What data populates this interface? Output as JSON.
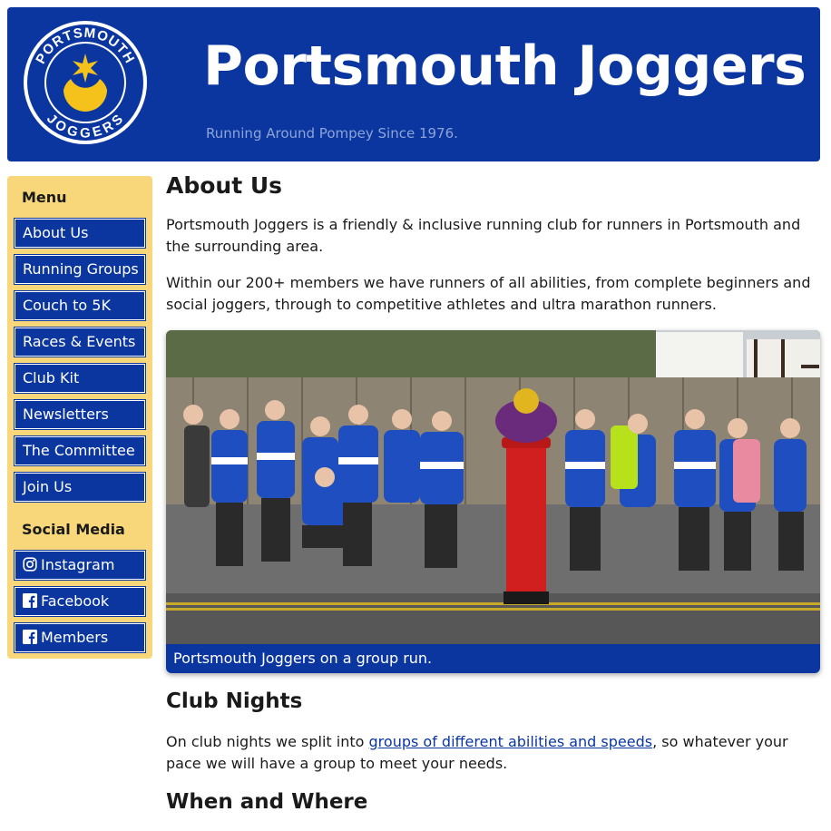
{
  "header": {
    "title": "Portsmouth Joggers",
    "tagline": "Running Around Pompey Since 1976.",
    "logo": {
      "top_text": "PORTSMOUTH",
      "bottom_text": "JOGGERS"
    },
    "brand_color": "#0b36a0",
    "accent_color": "#f5c21b"
  },
  "sidebar": {
    "menu_heading": "Menu",
    "menu": [
      "About Us",
      "Running Groups",
      "Couch to 5K",
      "Races & Events",
      "Club Kit",
      "Newsletters",
      "The Committee",
      "Join Us"
    ],
    "social_heading": "Social Media",
    "social": [
      {
        "label": "Instagram",
        "icon": "instagram-icon"
      },
      {
        "label": "Facebook",
        "icon": "facebook-icon"
      },
      {
        "label": "Members",
        "icon": "facebook-icon"
      }
    ],
    "background": "#f8d77a"
  },
  "main": {
    "heading": "About Us",
    "intro": "Portsmouth Joggers is a friendly & inclusive running club for runners in Portsmouth and the surrounding area.",
    "members_text": "Within our 200+ members we have runners of all abilities, from complete beginners and social joggers, through to competitive athletes and ultra marathon runners.",
    "photo_caption": "Portsmouth Joggers on a group run.",
    "club_nights": {
      "heading": "Club Nights",
      "text_before": "On club nights we split into ",
      "link": "groups of different abilities and speeds",
      "text_after": ", so whatever your pace we will have a group to meet your needs."
    },
    "when_where": {
      "heading": "When and Where"
    }
  }
}
